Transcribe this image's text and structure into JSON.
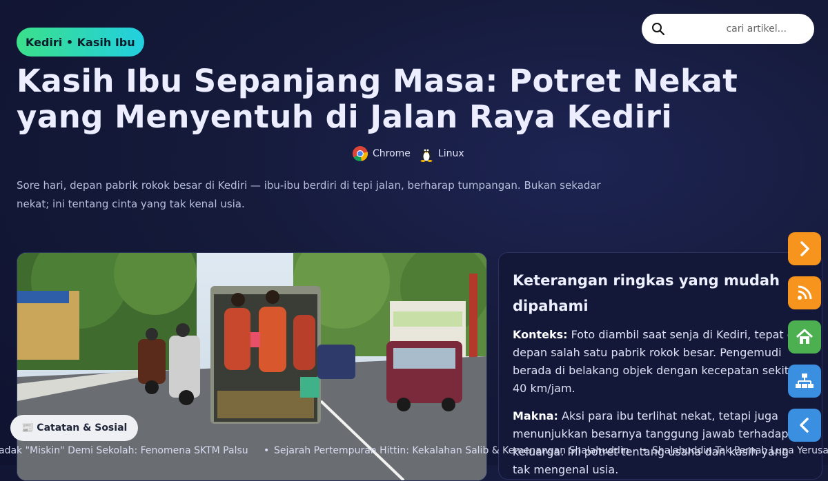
{
  "tag": {
    "label": "Kediri • Kasih Ibu"
  },
  "search": {
    "placeholder": "cari artikel..."
  },
  "article": {
    "title": "Kasih Ibu Sepanjang Masa: Potret Nekat yang Menyentuh di Jalan Raya Kediri",
    "platforms": [
      {
        "name": "Chrome",
        "icon": "chrome-icon"
      },
      {
        "name": "Linux",
        "icon": "linux-tux-icon"
      }
    ],
    "lead": "Sore hari, depan pabrik rokok besar di Kediri — ibu-ibu berdiri di tepi jalan, berharap tumpangan. Bukan sekadar nekat; ini tentang cinta yang tak kenal usia."
  },
  "summary": {
    "heading": "Keterangan ringkas yang mudah dipahami",
    "items": [
      {
        "label": "Konteks:",
        "text": "Foto diambil saat senja di Kediri, tepat di depan salah satu pabrik rokok besar. Pengemudi berada di belakang objek dengan kecepatan sekitar 40 km/jam."
      },
      {
        "label": "Makna:",
        "text": "Aksi para ibu terlihat nekat, tetapi juga menunjukkan besarnya tanggung jawab terhadap keluarga. Ini potret tentang usaha dan kasih yang tak mengenal usia."
      }
    ]
  },
  "side_buttons": [
    {
      "icon": "chevron-right-icon",
      "color": "#f7941d"
    },
    {
      "icon": "rss-icon",
      "color": "#f7941d"
    },
    {
      "icon": "home-icon",
      "color": "#4caf50"
    },
    {
      "icon": "sitemap-icon",
      "color": "#3b8fe0"
    },
    {
      "icon": "chevron-left-icon",
      "color": "#3b8fe0"
    }
  ],
  "category_chip": {
    "icon": "newspaper-icon",
    "label": "📰 Catatan & Sosial"
  },
  "ticker": [
    "adak \"Miskin\" Demi Sekolah: Fenomena SKTM Palsu",
    "Sejarah Pertempuran Hittin: Kekalahan Salib & Kemenangan Shalahuddin",
    "Shalahuddin Tak Pernah Lupa Yerusalem"
  ]
}
